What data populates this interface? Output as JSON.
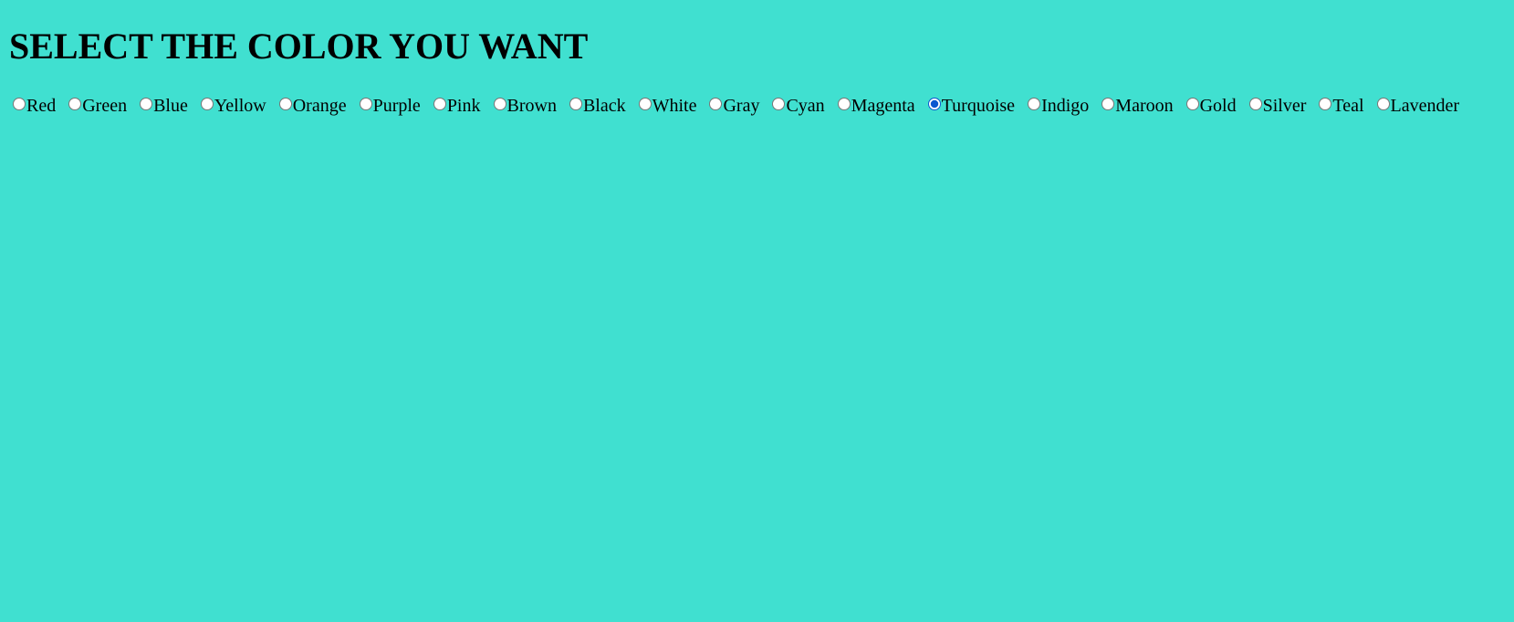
{
  "page": {
    "title": "SELECT THE COLOR YOU WANT",
    "background_color": "#40e0d0"
  },
  "color_options": {
    "selected": "Turquoise",
    "items": [
      {
        "label": "Red",
        "value": "Red"
      },
      {
        "label": "Green",
        "value": "Green"
      },
      {
        "label": "Blue",
        "value": "Blue"
      },
      {
        "label": "Yellow",
        "value": "Yellow"
      },
      {
        "label": "Orange",
        "value": "Orange"
      },
      {
        "label": "Purple",
        "value": "Purple"
      },
      {
        "label": "Pink",
        "value": "Pink"
      },
      {
        "label": "Brown",
        "value": "Brown"
      },
      {
        "label": "Black",
        "value": "Black"
      },
      {
        "label": "White",
        "value": "White"
      },
      {
        "label": "Gray",
        "value": "Gray"
      },
      {
        "label": "Cyan",
        "value": "Cyan"
      },
      {
        "label": "Magenta",
        "value": "Magenta"
      },
      {
        "label": "Turquoise",
        "value": "Turquoise"
      },
      {
        "label": "Indigo",
        "value": "Indigo"
      },
      {
        "label": "Maroon",
        "value": "Maroon"
      },
      {
        "label": "Gold",
        "value": "Gold"
      },
      {
        "label": "Silver",
        "value": "Silver"
      },
      {
        "label": "Teal",
        "value": "Teal"
      },
      {
        "label": "Lavender",
        "value": "Lavender"
      }
    ]
  }
}
